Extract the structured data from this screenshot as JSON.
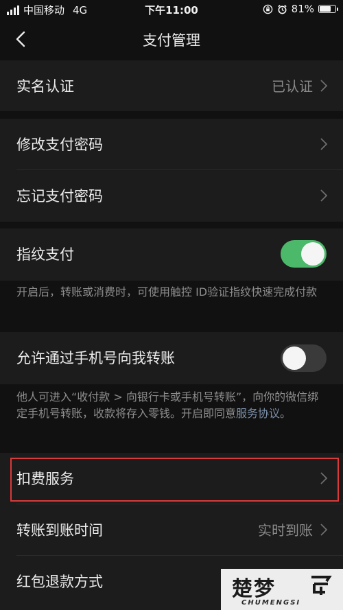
{
  "status_bar": {
    "carrier": "中国移动",
    "network": "4G",
    "time": "下午11:00",
    "battery": "81%",
    "battery_level": 0.81
  },
  "nav": {
    "title": "支付管理"
  },
  "rows": {
    "realname": {
      "label": "实名认证",
      "value": "已认证"
    },
    "change_pwd": {
      "label": "修改支付密码"
    },
    "forgot_pwd": {
      "label": "忘记支付密码"
    },
    "fingerprint": {
      "label": "指纹支付",
      "enabled": true
    },
    "phone_transfer": {
      "label": "允许通过手机号向我转账",
      "enabled": false
    },
    "deduction": {
      "label": "扣费服务"
    },
    "arrival_time": {
      "label": "转账到账时间",
      "value": "实时到账"
    },
    "refund": {
      "label": "红包退款方式"
    }
  },
  "notes": {
    "fingerprint": "开启后，转账或消费时，可使用触控 ID验证指纹快速完成付款",
    "phone_transfer": "他人可进入“收付款 > 向银行卡或手机号转账”，向你的微信绑定手机号转账，收款将存入零钱。开启即同意",
    "phone_transfer_link": "服务协议",
    "phone_transfer_end": "。"
  },
  "colors": {
    "background": "#111111",
    "card": "#1c1c1c",
    "toggle_on": "#4cb86a",
    "toggle_off": "#3a3a3a",
    "link": "#7d90a9",
    "highlight": "#d93a3a"
  },
  "watermark": {
    "zh": "楚梦",
    "en": "CHUMENGSI"
  }
}
